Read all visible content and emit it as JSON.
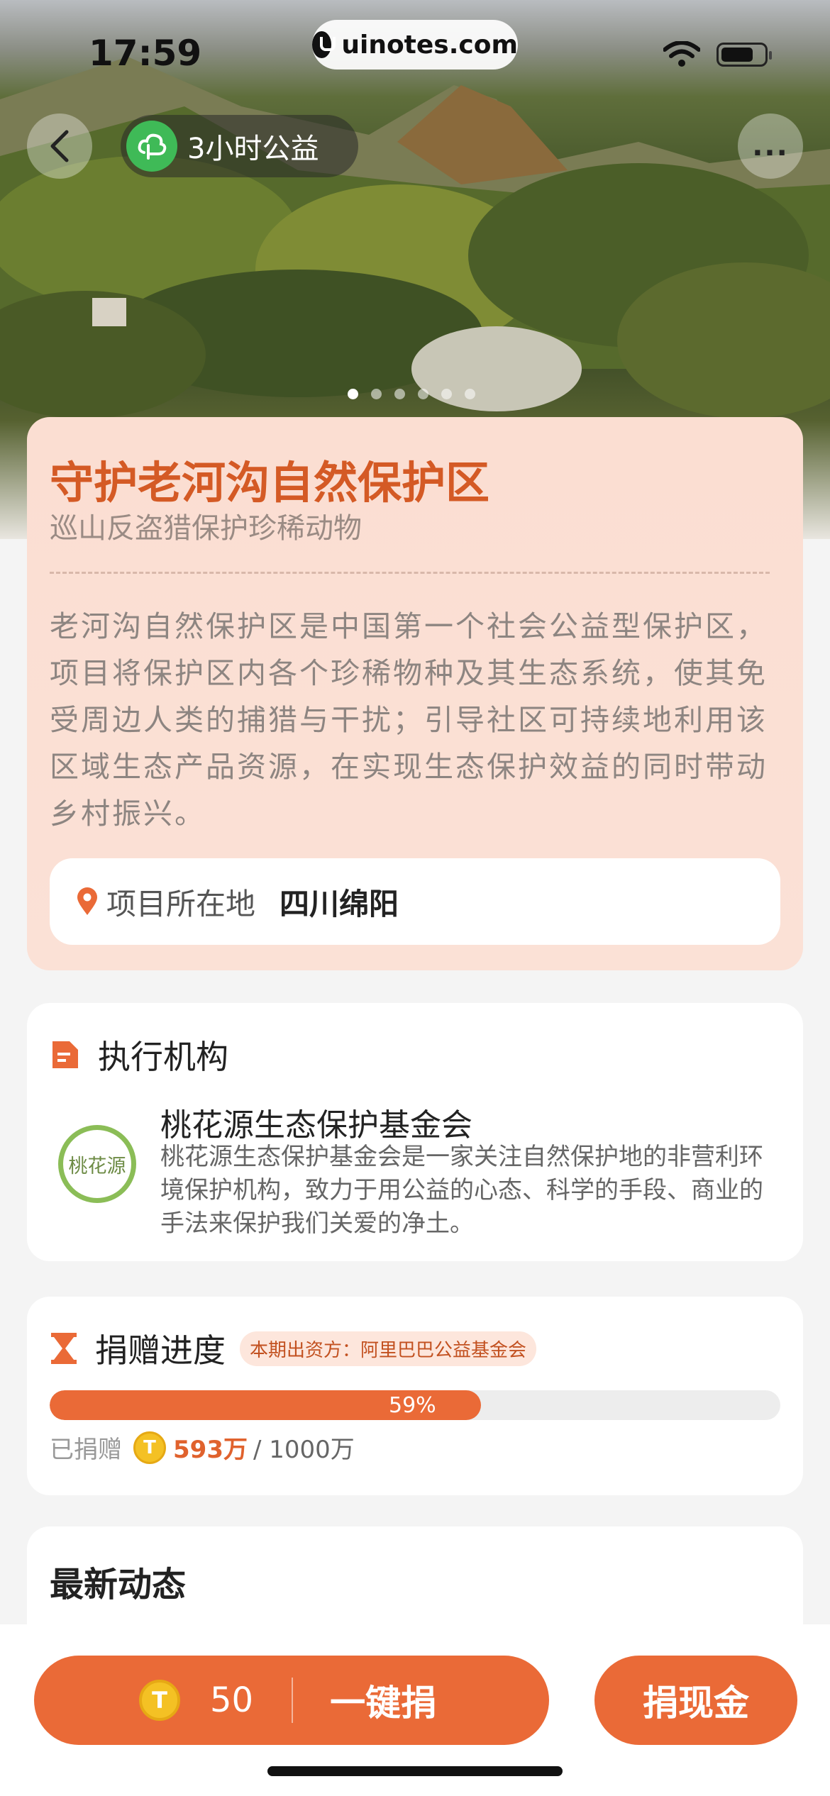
{
  "status_bar": {
    "time": "17:59",
    "url": "uinotes.com"
  },
  "header": {
    "charity_badge": "3小时公益",
    "more_label": "..."
  },
  "carousel": {
    "pages": [
      true,
      false,
      false,
      false,
      false,
      false
    ]
  },
  "project": {
    "title": "守护老河沟自然保护区",
    "subtitle": "巡山反盗猎保护珍稀动物",
    "description": "老河沟自然保护区是中国第一个社会公益型保护区，项目将保护区内各个珍稀物种及其生态系统，使其免受周边人类的捕猎与干扰；引导社区可持续地利用该区域生态产品资源，在实现生态保护效益的同时带动乡村振兴。",
    "location_label": "项目所在地",
    "location_value": "四川绵阳"
  },
  "organization": {
    "section_title": "执行机构",
    "logo_text": "桃花源",
    "name": "桃花源生态保护基金会",
    "description": "桃花源生态保护基金会是一家关注自然保护地的非营利环境保护机构，致力于用公益的心态、科学的手段、商业的手法来保护我们关爱的净土。"
  },
  "progress": {
    "section_title": "捐赠进度",
    "sponsor": "本期出资方：阿里巴巴公益基金会",
    "percent": 0.59,
    "percent_label": "59%",
    "donated_label": "已捐赠",
    "donated_value": "593万",
    "donated_total": "/ 1000万"
  },
  "news": {
    "section_title": "最新动态"
  },
  "bottom": {
    "coin_symbol": "T",
    "quick_amount": "50",
    "quick_label": "一键捐",
    "cash_label": "捐现金"
  },
  "colors": {
    "accent": "#ea6a37",
    "title": "#d45a25",
    "card_bg": "#fbded2",
    "charity_green": "#3fba57"
  }
}
